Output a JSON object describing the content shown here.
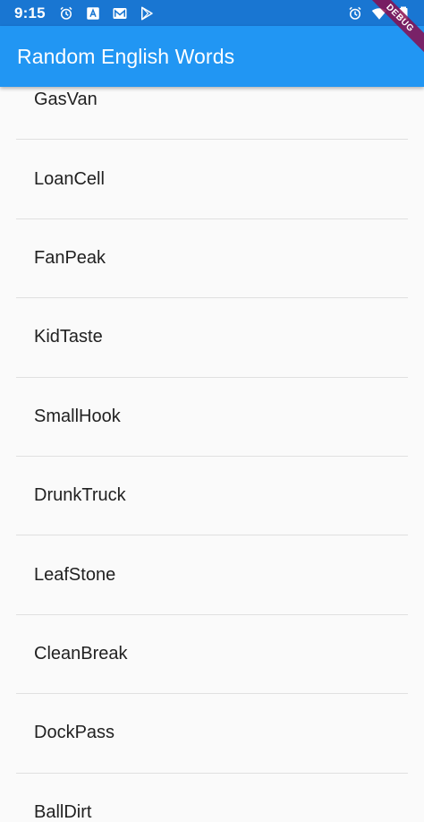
{
  "status_bar": {
    "time": "9:15",
    "left_icons": [
      "alarm-icon",
      "text-badge-icon",
      "mail-icon",
      "play-store-icon"
    ],
    "right_icons": [
      "alarm-icon",
      "wifi-icon",
      "battery-icon"
    ],
    "background": "#1976d2"
  },
  "app_bar": {
    "title": "Random English Words",
    "background": "#2196f3"
  },
  "debug_banner": {
    "label": "DEBUG",
    "color": "#880e4f"
  },
  "words": [
    "GasVan",
    "LoanCell",
    "FanPeak",
    "KidTaste",
    "SmallHook",
    "DrunkTruck",
    "LeafStone",
    "CleanBreak",
    "DockPass",
    "BallDirt"
  ]
}
